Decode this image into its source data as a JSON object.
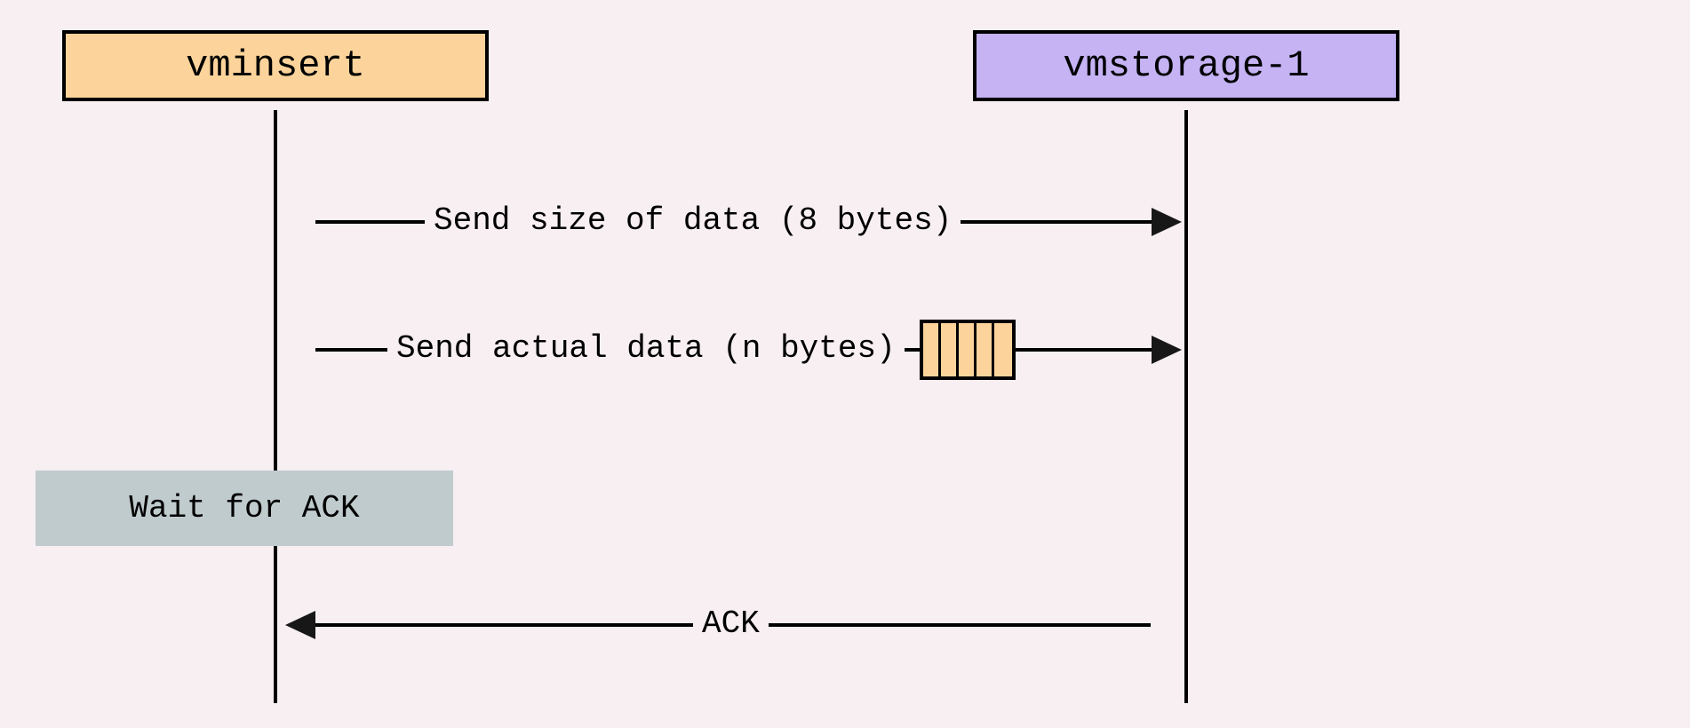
{
  "participants": {
    "left": "vminsert",
    "right": "vmstorage-1"
  },
  "messages": {
    "send_size": "Send size of data (8 bytes)",
    "send_data": "Send actual data (n bytes)",
    "ack": "ACK"
  },
  "note": {
    "wait": "Wait  for ACK"
  },
  "data_bars_count": 5
}
